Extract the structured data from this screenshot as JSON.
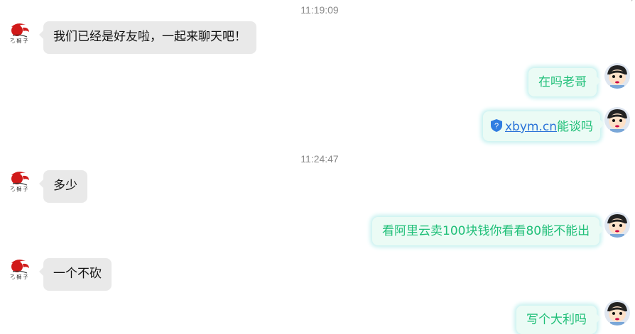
{
  "messages": {
    "t1": "11:19:09",
    "m1": "我们已经是好友啦，一起来聊天吧！",
    "m2": "在吗老哥",
    "m3_link": "xbym.cn",
    "m3_rest": "能谈吗",
    "t2": "11:24:47",
    "m4": "多少",
    "m5": "看阿里云卖100块钱你看看80能不能出",
    "m6": "一个不砍",
    "m7": "写个大利吗"
  },
  "corner_mark": "ˊ",
  "icons": {
    "contact_avatar": "red-lion-logo-avatar",
    "self_avatar": "cartoon-boy-avatar",
    "link_badge": "blue-shield-icon"
  },
  "colors": {
    "incoming_bubble": "#e9e9e9",
    "outgoing_bubble": "#ebfbf5",
    "outgoing_text": "#1fbf78",
    "link": "#2a73d8"
  }
}
